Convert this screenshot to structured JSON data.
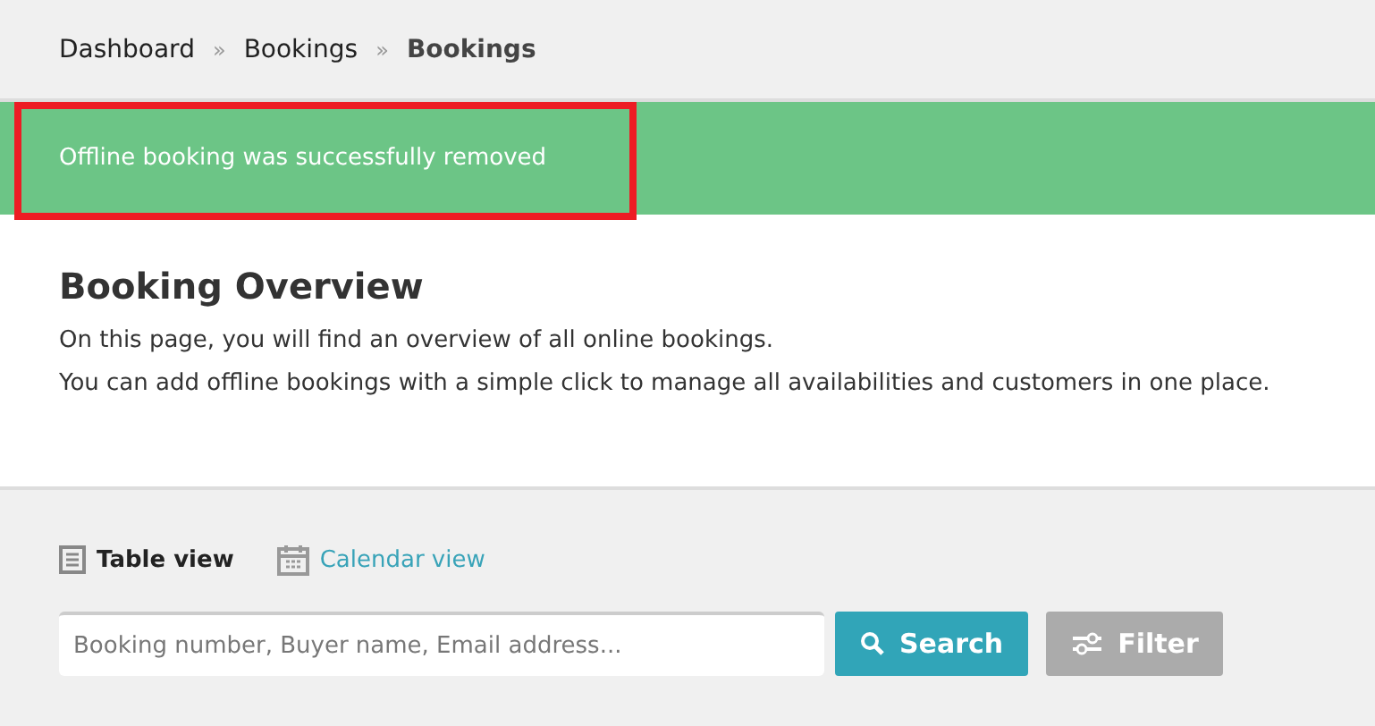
{
  "breadcrumb": [
    {
      "label": "Dashboard",
      "current": false
    },
    {
      "label": "Bookings",
      "current": false
    },
    {
      "label": "Bookings",
      "current": true
    }
  ],
  "breadcrumb_separator": "»",
  "alert": {
    "message": "Offline booking was successfully removed",
    "highlighted": true
  },
  "overview": {
    "title": "Booking Overview",
    "lines": [
      "On this page, you will find an overview of all online bookings.",
      "You can add offline bookings with a simple click to manage all availabilities and customers in one place."
    ]
  },
  "views": [
    {
      "label": "Table view",
      "kind": "table",
      "selected": true
    },
    {
      "label": "Calendar view",
      "kind": "calendar",
      "selected": false
    }
  ],
  "search": {
    "placeholder": "Booking number, Buyer name, Email address..."
  },
  "buttons": [
    {
      "label": "Search",
      "kind": "search"
    },
    {
      "label": "Filter",
      "kind": "filter"
    }
  ]
}
